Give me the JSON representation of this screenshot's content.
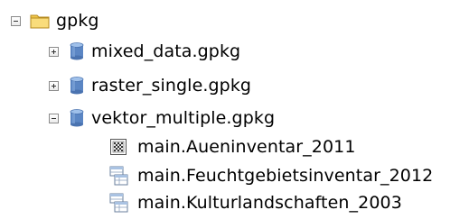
{
  "tree": {
    "root": {
      "label": "gpkg",
      "expanded": true,
      "icon": "folder-icon"
    },
    "databases": [
      {
        "label": "mixed_data.gpkg",
        "expanded": false,
        "icon": "database-icon"
      },
      {
        "label": "raster_single.gpkg",
        "expanded": false,
        "icon": "database-icon"
      },
      {
        "label": "vektor_multiple.gpkg",
        "expanded": true,
        "icon": "database-icon"
      }
    ],
    "layers": [
      {
        "label": "main.Aueninventar_2011",
        "icon": "raster-layer-icon"
      },
      {
        "label": "main.Feuchtgebietsinventar_2012",
        "icon": "vector-layer-icon"
      },
      {
        "label": "main.Kulturlandschaften_2003",
        "icon": "vector-layer-icon"
      }
    ]
  },
  "colors": {
    "folder": "#f2c84b",
    "database": "#5b86c4",
    "toggle_border": "#8a8a8a"
  }
}
